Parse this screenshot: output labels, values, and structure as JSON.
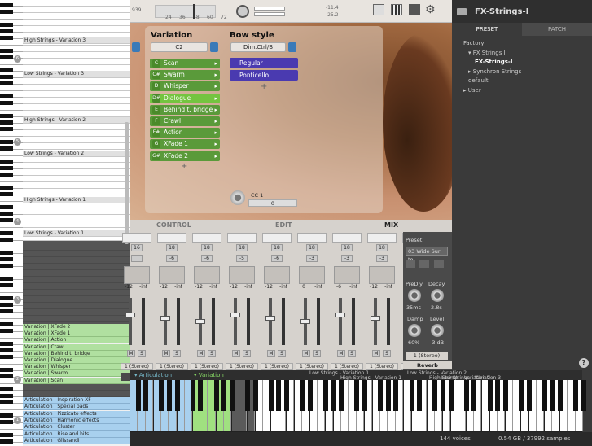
{
  "header": {
    "meter_left": "939",
    "ruler": [
      "24",
      "36",
      "48",
      "60",
      "72"
    ],
    "level_top": "-11.4",
    "level_bottom": "-25.2"
  },
  "toolbar_icons": [
    "resize-icon",
    "piano-icon",
    "chip-icon",
    "gear-icon",
    "folder-icon"
  ],
  "preset_panel": {
    "title": "FX-Strings-I",
    "tabs": [
      "PRESET",
      "PATCH"
    ],
    "tree": [
      "Factory",
      "FX Strings I",
      "FX-Strings-I",
      "Synchron Strings I",
      "default",
      "User"
    ]
  },
  "variation": {
    "heading": "Variation",
    "dropdown": "C2",
    "items": [
      {
        "key": "C",
        "label": "Scan"
      },
      {
        "key": "C#",
        "label": "Swarm"
      },
      {
        "key": "D",
        "label": "Whisper"
      },
      {
        "key": "D#",
        "label": "Dialogue"
      },
      {
        "key": "E",
        "label": "Behind t. bridge"
      },
      {
        "key": "F",
        "label": "Crawl"
      },
      {
        "key": "F#",
        "label": "Action"
      },
      {
        "key": "G",
        "label": "XFade 1"
      },
      {
        "key": "G#",
        "label": "XFade 2"
      }
    ],
    "add": "+"
  },
  "bowstyle": {
    "heading": "Bow style",
    "dropdown": "Dim.Ctrl/B",
    "items": [
      "Regular",
      "Ponticello"
    ],
    "add": "+"
  },
  "cc": {
    "label": "CC 1",
    "value": "0"
  },
  "left_list": {
    "labels": [
      "High Strings - Variation 3",
      "Low Strings - Variation 3",
      "High Strings - Variation 2",
      "Low Strings - Variation 2",
      "High Strings - Variation 1",
      "Low Strings - Variation 1"
    ],
    "green": [
      "Variation | XFade 2",
      "Variation | XFade 1",
      "Variation | Action",
      "Variation | Crawl",
      "Variation | Behind t. bridge",
      "Variation | Dialogue",
      "Variation | Whisper",
      "Variation | Swarm",
      "Variation | Scan"
    ],
    "blue": [
      "Articulation | Inspiration XF",
      "Articulation | Special pads",
      "Articulation | Pizzicato effects",
      "Articulation | Harmonic effects",
      "Articulation | Cluster",
      "Articulation | Rise and hits",
      "Articulation | Glissandi"
    ],
    "c_marks": [
      "6",
      "5",
      "4",
      "3",
      "2",
      "1",
      "0"
    ]
  },
  "mixer": {
    "tabs": [
      "CONTROL",
      "EDIT",
      "MIX"
    ],
    "strips": [
      {
        "name": "e",
        "n1": "16",
        "n2": "",
        "v1": "-12",
        "v2": "-inf"
      },
      {
        "name": "VaHi-Close",
        "n1": "18",
        "n2": "-6",
        "v1": "-12",
        "v2": "-inf"
      },
      {
        "name": "VaLo-Close",
        "n1": "18",
        "n2": "-6",
        "v1": "-12",
        "v2": "-inf"
      },
      {
        "name": "Vc-Close",
        "n1": "18",
        "n2": "-5",
        "v1": "-12",
        "v2": "-inf"
      },
      {
        "name": "DB-Close",
        "n1": "18",
        "n2": "-6",
        "v1": "-12",
        "v2": "-inf"
      },
      {
        "name": "Mid-High",
        "n1": "18",
        "n2": "-3",
        "v1": "0",
        "v2": "-inf"
      },
      {
        "name": "Mid-Low",
        "n1": "18",
        "n2": "-3",
        "v1": "-6",
        "v2": "-inf"
      },
      {
        "name": "Back-High",
        "n1": "18",
        "n2": "-3",
        "v1": "-12",
        "v2": "-inf"
      },
      {
        "name": "Back",
        "n1": "18",
        "n2": "-6",
        "v1": "-12",
        "v2": "-inf"
      }
    ],
    "ms": [
      "M",
      "S"
    ],
    "output": "1 (Stereo)"
  },
  "reverb": {
    "preset_label": "Preset:",
    "preset": "03 Wide Sur to",
    "knobs": [
      {
        "label": "PreDly",
        "value": "35ms"
      },
      {
        "label": "Decay",
        "value": "2.8s"
      },
      {
        "label": "Damp",
        "value": "60%"
      },
      {
        "label": "Level",
        "value": "-3 dB"
      }
    ],
    "output": "1 (Stereo)",
    "name": "Reverb"
  },
  "bottom": {
    "articulation": "Articulation",
    "variation": "Variation",
    "ranges": [
      "Low Strings - Variation 1",
      "High Strings - Variation 1",
      "Low Strings - Variation 2",
      "High Strings - Variation 2",
      "Low Strings - Variation 3"
    ],
    "voices": "144 voices",
    "memory": "0.54 GB / 37992 samples"
  }
}
